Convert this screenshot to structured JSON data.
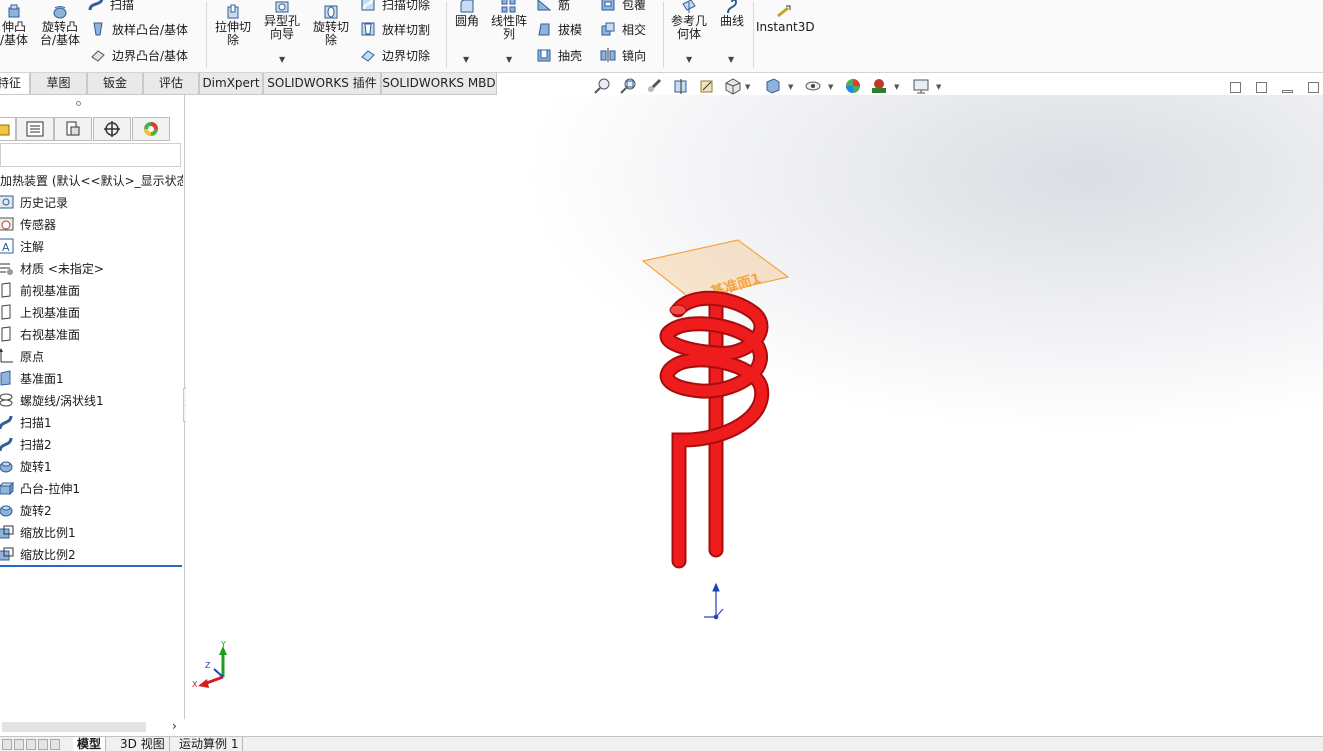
{
  "ribbon": {
    "boss_base": "伸凸\n/基体",
    "revolve_boss": "旋转凸\n台/基体",
    "sweep": "扫描",
    "loft_boss": "放样凸台/基体",
    "boundary_boss": "边界凸台/基体",
    "extrude_cut": "拉伸切\n除",
    "hole_wizard": "异型孔\n向导",
    "revolve_cut": "旋转切\n除",
    "swept_cut": "扫描切除",
    "loft_cut": "放样切割",
    "boundary_cut": "边界切除",
    "fillet": "圆角",
    "linear_pattern": "线性阵\n列",
    "rib": "筋",
    "draft": "拔模",
    "shell": "抽壳",
    "wrap": "包覆",
    "intersect": "相交",
    "mirror": "镜向",
    "ref_geometry": "参考几\n何体",
    "curves": "曲线",
    "instant3d": "Instant3D"
  },
  "command_tabs": [
    "特征",
    "草图",
    "钣金",
    "评估",
    "DimXpert",
    "SOLIDWORKS 插件",
    "SOLIDWORKS MBD"
  ],
  "tree": {
    "root": "加热装置 (默认<<默认>_显示状态",
    "items": [
      {
        "label": "历史记录",
        "icon": "history-icon"
      },
      {
        "label": "传感器",
        "icon": "sensor-icon"
      },
      {
        "label": "注解",
        "icon": "annotation-icon"
      },
      {
        "label": "材质 <未指定>",
        "icon": "material-icon"
      },
      {
        "label": "前视基准面",
        "icon": "plane-icon"
      },
      {
        "label": "上视基准面",
        "icon": "plane-icon"
      },
      {
        "label": "右视基准面",
        "icon": "plane-icon"
      },
      {
        "label": "原点",
        "icon": "origin-icon"
      },
      {
        "label": "基准面1",
        "icon": "plane-feature-icon"
      },
      {
        "label": "螺旋线/涡状线1",
        "icon": "helix-icon"
      },
      {
        "label": "扫描1",
        "icon": "sweep-icon"
      },
      {
        "label": "扫描2",
        "icon": "sweep-icon"
      },
      {
        "label": "旋转1",
        "icon": "revolve-icon"
      },
      {
        "label": "凸台-拉伸1",
        "icon": "extrude-icon"
      },
      {
        "label": "旋转2",
        "icon": "revolve-icon"
      },
      {
        "label": "缩放比例1",
        "icon": "scale-icon"
      },
      {
        "label": "缩放比例2",
        "icon": "scale-icon"
      }
    ]
  },
  "viewport": {
    "plane_label": "基准面1",
    "triad_x": "X",
    "triad_y": "Y",
    "triad_z": "Z",
    "model_color": "#ee1c1c",
    "plane_color": "#f5a442"
  },
  "bottom_tabs": [
    "模型",
    "3D 视图",
    "运动算例 1"
  ]
}
